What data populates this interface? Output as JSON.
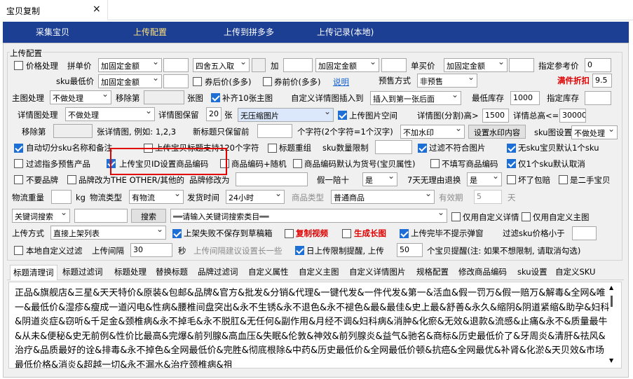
{
  "tab": {
    "title": "宝贝复制",
    "close": "×"
  },
  "nav": [
    "采集宝贝",
    "上传配置",
    "上传到拼多多",
    "上传记录(本地)"
  ],
  "group_title": "上传配置",
  "r1": {
    "price_proc": "价格处理",
    "pin_price": "拼单价",
    "sel1": "加固定金额",
    "sel2": "四舍五入取",
    "add": "加",
    "sel3": "加固定金额",
    "buy_price": "单买价",
    "sel4": "加固定金额",
    "ref_price": "指定参考价",
    "ref_val": "0"
  },
  "r2": {
    "sku_min": "sku最低价",
    "sel1": "加固定金额",
    "after_coupon": "券后价(多多)",
    "coupon_price": "券前价(多多)",
    "explain": "说明",
    "presale": "预售方式",
    "presale_val": "非预售",
    "discount": "满件折扣",
    "discount_val": "9.5"
  },
  "r3": {
    "main_proc": "主图处理",
    "main_val": "不做处理",
    "remove": "移除第",
    "pic": "张图",
    "fill": "补齐10张主图",
    "custom_detail": "自定义详情图插入到",
    "insert_val": "插入到第一张后面",
    "min_stock": "最低库存",
    "min_stock_val": "1000",
    "stock": "指定库存"
  },
  "r4": {
    "detail_proc": "详情图处理",
    "detail_val": "不做处理",
    "keep": "详情图保留",
    "keep_val": "20",
    "zhang": "张",
    "compress": "无压缩图片",
    "space": "上传图片空间",
    "height": "详情图(分割)高>",
    "height_val": "1500",
    "total": "详情总高<=",
    "total_val": "30000"
  },
  "r5": {
    "remove": "移除第",
    "example": "张详情图, 例如: 1,2,3",
    "newtitle": "新标题只保留前",
    "chars": "个字符(2个字符=1个汉字)",
    "watermark": "不加水印",
    "wm_btn": "设置水印内容",
    "sku_set": "sku图设置",
    "sku_val": "不做处理"
  },
  "r6": {
    "split": "自动切分sku名称和备注",
    "desc": "上传宝贝标题支持120个字符",
    "title_regroup": "标题重组",
    "sku_limit": "sku数量限制",
    "filter": "过滤不符合图片",
    "nosku": "无sku宝贝默认1个sku"
  },
  "r7": {
    "filter_presale": "过滤指多预售产品",
    "id_code": "上传宝贝ID设置商品编码",
    "rand_code": "商品编码+随机",
    "default_code": "商品编码默认为货号(宝贝属性)",
    "no_fill": "不填写商品编码",
    "only1": "仅1个sku默认取消"
  },
  "r8": {
    "no_brand": "不要品牌",
    "brand_change": "品牌改为THE OTHER/其他的",
    "brand_edit": "品牌修改为",
    "fake": "假一陪十",
    "fake_val": "是",
    "seven": "7天无理由退换",
    "seven_val": "是",
    "broken": "坏了包赔",
    "second": "是二手宝贝"
  },
  "r9": {
    "weight": "物流重量",
    "kg": "kg",
    "logi_type": "物流类型",
    "logi_val": "有物流",
    "ship": "发货时间",
    "ship_val": "24小时",
    "prod_type": "商品类型",
    "prod_val": "普通商品",
    "valid": "有效期",
    "valid_val": "5",
    "day": "天"
  },
  "r10": {
    "kw_search": "关键词搜索",
    "search": "搜索",
    "cat_placeholder": "══请输入关键词搜索类目══",
    "custom_detail": "仅用自定义详情",
    "custom_main": "仅用自定义主图"
  },
  "r11": {
    "upload_mode": "上传方式",
    "mode_val": "直接上架列表",
    "fail_save": "上架失败不保存到草稿箱",
    "copy_video": "复制视频",
    "gen_long": "生成长图",
    "no_popup": "上传完毕不提示弹窗",
    "filter_sku": "过滤sku价格小于"
  },
  "r12": {
    "local_filter": "本地自定义过滤",
    "interval": "上传间隔",
    "interval_val": "30",
    "sec": "秒",
    "suggest": "上传间隔建议设置长一些",
    "daily": "日上传限制提醒, 上传",
    "daily_val": "50",
    "tip": "个宝贝提醒(注: 如果不想限制, 请取消勾选)"
  },
  "tabs": [
    "标题清理词",
    "标题过滤词",
    "标题处理",
    "替换标题",
    "品牌过滤词",
    "自定义属性",
    "自定义主图",
    "自定义详情图片",
    "规格配置",
    "修改商品编码",
    "sku设置",
    "自定义SKU"
  ],
  "content": "正品&旗舰店&三星&天天特价&原装&包邮&品牌&官方&批发&分销&代理&一键代发&一件代发&第一&活血&假一罚万&假一赔万&解毒&全网&唯一&最低价&湿疹&瘦成一道闪电&性病&腰椎间盘突出&永不生锈&永不退色&永不褪色&最&最佳&史上最&舒善&永久&缩阴&阴道紧缩&助孕&妇科&阴道炎症&窃听&千足金&颈椎病&永不掉毛&永不脱肛&无任何&副作用&月经不调&妇科病&消肿&化瘀&无效&退款&流感&止痛&永不&质量最牛&从未&便秘&史无前例&性价比最高&完爆&前列腺&高血压&失眠&伦敦&神效&前列腺炎&益气&驰名&商标&历史最低价了&牙周炎&清肝&祛风&治疗&品质最好的诠&排毒&永不掉色&全网最低价&完胜&彻底根除&中药&历史最低价&全网最低价顿&抗癌&全网最优&补肾&化淤&天贝效&市场最低价格&消炎&超越一切&永不漏水&治疗颈椎病&祖"
}
